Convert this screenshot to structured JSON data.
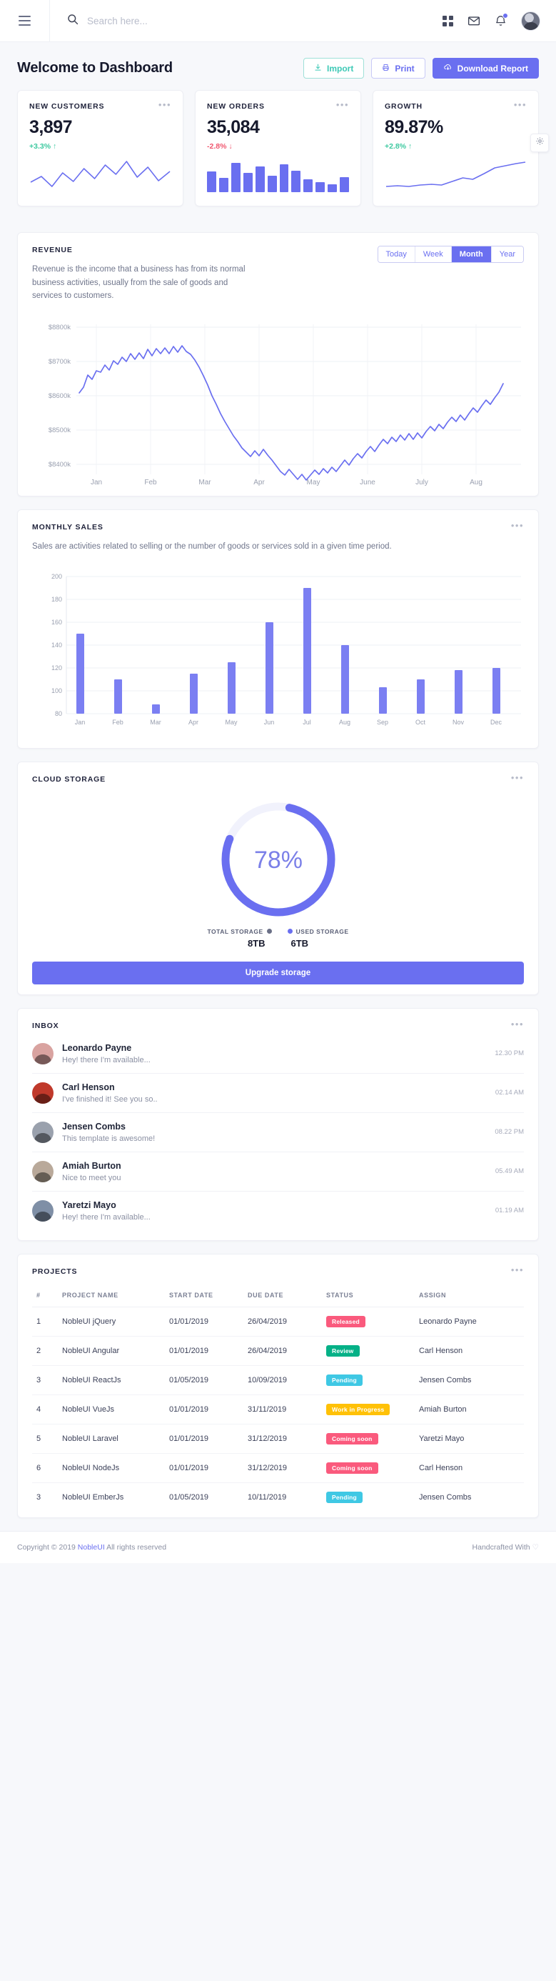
{
  "topnav": {
    "search_placeholder": "Search here...",
    "icons": [
      "menu-icon",
      "search-icon",
      "apps-grid-icon",
      "mail-icon",
      "bell-icon",
      "avatar"
    ]
  },
  "header": {
    "title": "Welcome to Dashboard",
    "import_label": "Import",
    "print_label": "Print",
    "download_label": "Download Report"
  },
  "stats": [
    {
      "title": "NEW CUSTOMERS",
      "value": "3,897",
      "delta": "+3.3%",
      "arrow": "↑",
      "dir": "up",
      "spark": "line"
    },
    {
      "title": "NEW ORDERS",
      "value": "35,084",
      "delta": "-2.8%",
      "arrow": "↓",
      "dir": "down",
      "spark": "bars"
    },
    {
      "title": "GROWTH",
      "value": "89.87%",
      "delta": "+2.8%",
      "arrow": "↑",
      "dir": "up",
      "spark": "line2"
    }
  ],
  "revenue": {
    "title": "REVENUE",
    "description": "Revenue is the income that a business has from its normal business activities, usually from the sale of goods and services to customers.",
    "tabs": [
      "Today",
      "Week",
      "Month",
      "Year"
    ],
    "active_tab": "Month"
  },
  "monthly_sales": {
    "title": "MONTHLY SALES",
    "description": "Sales are activities related to selling or the number of goods or services sold in a given time period."
  },
  "cloud_storage": {
    "title": "CLOUD STORAGE",
    "percent": "78%",
    "total_label": "TOTAL STORAGE",
    "used_label": "USED STORAGE",
    "total_value": "8TB",
    "used_value": "6TB",
    "upgrade_label": "Upgrade storage"
  },
  "inbox": {
    "title": "INBOX",
    "items": [
      {
        "name": "Leonardo Payne",
        "message": "Hey! there I'm available...",
        "time": "12.30 PM",
        "color": "#d9a3a0"
      },
      {
        "name": "Carl Henson",
        "message": "I've finished it! See you so..",
        "time": "02.14 AM",
        "color": "#c0392b"
      },
      {
        "name": "Jensen Combs",
        "message": "This template is awesome!",
        "time": "08.22 PM",
        "color": "#9aa1ad"
      },
      {
        "name": "Amiah Burton",
        "message": "Nice to meet you",
        "time": "05.49 AM",
        "color": "#b9a99a"
      },
      {
        "name": "Yaretzi Mayo",
        "message": "Hey! there I'm available...",
        "time": "01.19 AM",
        "color": "#7f8fa6"
      }
    ]
  },
  "projects": {
    "title": "PROJECTS",
    "columns": [
      "#",
      "PROJECT NAME",
      "START DATE",
      "DUE DATE",
      "STATUS",
      "ASSIGN"
    ],
    "rows": [
      {
        "n": "1",
        "name": "NobleUI jQuery",
        "start": "01/01/2019",
        "due": "26/04/2019",
        "status": "Released",
        "status_color": "#fa5a7d",
        "assign": "Leonardo Payne"
      },
      {
        "n": "2",
        "name": "NobleUI Angular",
        "start": "01/01/2019",
        "due": "26/04/2019",
        "status": "Review",
        "status_color": "#05b187",
        "assign": "Carl Henson"
      },
      {
        "n": "3",
        "name": "NobleUI ReactJs",
        "start": "01/05/2019",
        "due": "10/09/2019",
        "status": "Pending",
        "status_color": "#3fc8e4",
        "assign": "Jensen Combs"
      },
      {
        "n": "4",
        "name": "NobleUI VueJs",
        "start": "01/01/2019",
        "due": "31/11/2019",
        "status": "Work in Progress",
        "status_color": "#ffc107",
        "assign": "Amiah Burton"
      },
      {
        "n": "5",
        "name": "NobleUI Laravel",
        "start": "01/01/2019",
        "due": "31/12/2019",
        "status": "Coming soon",
        "status_color": "#fa5a7d",
        "assign": "Yaretzi Mayo"
      },
      {
        "n": "6",
        "name": "NobleUI NodeJs",
        "start": "01/01/2019",
        "due": "31/12/2019",
        "status": "Coming soon",
        "status_color": "#fa5a7d",
        "assign": "Carl Henson"
      },
      {
        "n": "3",
        "name": "NobleUI EmberJs",
        "start": "01/05/2019",
        "due": "10/11/2019",
        "status": "Pending",
        "status_color": "#3fc8e4",
        "assign": "Jensen Combs"
      }
    ]
  },
  "footer": {
    "copyright_prefix": "Copyright © 2019",
    "brand": "NobleUI",
    "copyright_suffix": "All rights reserved",
    "handcrafted": "Handcrafted With",
    "heart": "♡"
  },
  "colors": {
    "accent": "#6a6ff0",
    "up": "#3ec9a0",
    "down": "#f0576f",
    "track": "#eef0fb"
  },
  "chart_data": [
    {
      "type": "line",
      "name": "revenue-chart",
      "title": "REVENUE",
      "xlabel": "",
      "ylabel": "",
      "ylim": [
        8350,
        8850
      ],
      "ytick_labels": [
        "$8800k",
        "$8700k",
        "$8600k",
        "$8500k",
        "$8400k"
      ],
      "yticks": [
        8800,
        8700,
        8600,
        8500,
        8400
      ],
      "xtick_labels": [
        "Jan",
        "Feb",
        "Mar",
        "Apr",
        "May",
        "June",
        "July",
        "Aug"
      ],
      "grid": true,
      "legend": "none",
      "series": [
        {
          "name": "Revenue",
          "color": "#6a6ff0",
          "values": [
            8608,
            8625,
            8660,
            8648,
            8672,
            8668,
            8690,
            8676,
            8702,
            8688,
            8712,
            8700,
            8724,
            8708,
            8730,
            8716,
            8742,
            8726,
            8748,
            8734,
            8752,
            8736,
            8756,
            8742,
            8760,
            8744,
            8736,
            8720,
            8700,
            8676,
            8650,
            8620,
            8596,
            8570,
            8548,
            8528,
            8508,
            8492,
            8474,
            8462,
            8450,
            8466,
            8452,
            8470,
            8454,
            8440,
            8424,
            8408,
            8396,
            8412,
            8398,
            8384,
            8398,
            8382,
            8396,
            8410,
            8398,
            8414,
            8402,
            8418,
            8406,
            8422,
            8438,
            8424,
            8442,
            8456,
            8444,
            8462,
            8476,
            8462,
            8480,
            8496,
            8484,
            8502,
            8490,
            8508,
            8494,
            8512,
            8498,
            8516,
            8502,
            8520,
            8534,
            8522,
            8540,
            8528,
            8546,
            8560,
            8548,
            8566,
            8554,
            8572,
            8588,
            8576,
            8594,
            8610,
            8598,
            8616,
            8632,
            8658
          ]
        }
      ]
    },
    {
      "type": "bar",
      "name": "monthly-sales-chart",
      "title": "MONTHLY SALES",
      "categories": [
        "Jan",
        "Feb",
        "Mar",
        "Apr",
        "May",
        "Jun",
        "Jul",
        "Aug",
        "Sep",
        "Oct",
        "Nov",
        "Dec"
      ],
      "values": [
        150,
        110,
        88,
        115,
        125,
        160,
        190,
        140,
        103,
        110,
        118,
        120
      ],
      "ylim": [
        80,
        200
      ],
      "yticks": [
        80,
        100,
        120,
        140,
        160,
        180,
        200
      ],
      "ytick_labels": [
        "80",
        "100",
        "120",
        "140",
        "160",
        "180",
        "200"
      ],
      "grid": true,
      "color": "#7b7ff2",
      "xlabel": "",
      "ylabel": ""
    },
    {
      "type": "pie",
      "name": "cloud-storage-donut",
      "title": "CLOUD STORAGE",
      "labels": [
        "Used storage",
        "Free storage"
      ],
      "values": [
        78,
        22
      ],
      "colors": [
        "#6a6ff0",
        "#f1f2fc"
      ],
      "center_label": "78%"
    },
    {
      "type": "line",
      "name": "new-customers-sparkline",
      "values": [
        30,
        48,
        22,
        58,
        34,
        66,
        40,
        72,
        52,
        84,
        46,
        70,
        38,
        60
      ],
      "color": "#6a6ff0"
    },
    {
      "type": "bar",
      "name": "new-orders-sparkline",
      "values": [
        62,
        44,
        90,
        58,
        78,
        50,
        84,
        66,
        40,
        30,
        24,
        46
      ],
      "color": "#6a6ff0"
    },
    {
      "type": "line",
      "name": "growth-sparkline",
      "values": [
        20,
        22,
        21,
        24,
        26,
        25,
        30,
        36,
        34,
        44,
        56,
        62,
        70,
        74
      ],
      "color": "#6a6ff0"
    }
  ]
}
